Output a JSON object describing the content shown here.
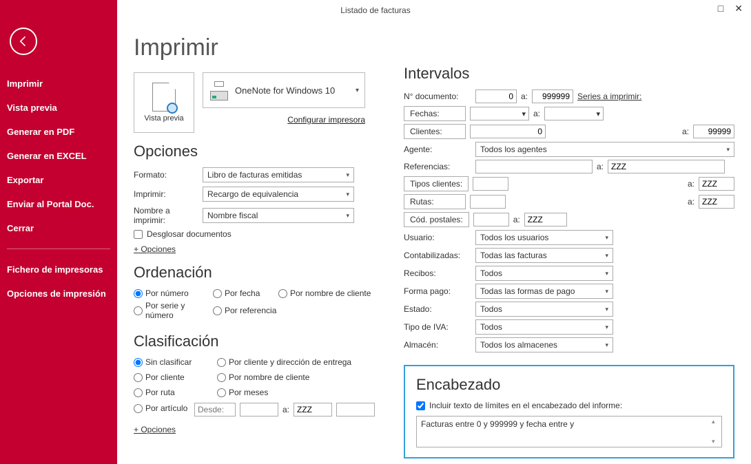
{
  "window": {
    "title": "Listado de facturas"
  },
  "sidebar": {
    "items": [
      "Imprimir",
      "Vista previa",
      "Generar en PDF",
      "Generar en EXCEL",
      "Exportar",
      "Enviar al Portal Doc.",
      "Cerrar"
    ],
    "items2": [
      "Fichero de impresoras",
      "Opciones de impresión"
    ]
  },
  "main": {
    "title": "Imprimir",
    "preview_label": "Vista previa",
    "printer": "OneNote for Windows 10",
    "config_link": "Configurar impresora",
    "opciones_title": "Opciones",
    "formato_label": "Formato:",
    "formato_value": "Libro de facturas emitidas",
    "imprimir_label": "Imprimir:",
    "imprimir_value": "Recargo de equivalencia",
    "nombre_label": "Nombre a imprimir:",
    "nombre_value": "Nombre fiscal",
    "desglosar": "Desglosar documentos",
    "opciones_link": "+ Opciones",
    "ordenacion_title": "Ordenación",
    "orden": [
      "Por número",
      "Por fecha",
      "Por nombre de cliente",
      "Por serie y número",
      "Por referencia"
    ],
    "clasif_title": "Clasificación",
    "clasif": [
      "Sin clasificar",
      "Por cliente y dirección de entrega",
      "Por cliente",
      "Por nombre de cliente",
      "Por ruta",
      "Por meses",
      "Por artículo"
    ],
    "desde": "Desde:",
    "a": "a:",
    "zzz": "ZZZ"
  },
  "intervals": {
    "title": "Intervalos",
    "ndoc": "N° documento:",
    "ndoc_from": "0",
    "ndoc_to": "999999",
    "series": "Series a imprimir:",
    "fechas": "Fechas:",
    "clientes": "Clientes:",
    "cli_from": "0",
    "cli_to": "99999",
    "agente": "Agente:",
    "agente_val": "Todos los agentes",
    "refs": "Referencias:",
    "refs_to": "ZZZ",
    "tipos_cli": "Tipos clientes:",
    "tipos_to": "ZZZ",
    "rutas": "Rutas:",
    "rutas_to": "ZZZ",
    "cpostales": "Cód. postales:",
    "cp_to": "ZZZ",
    "usuario": "Usuario:",
    "usuario_val": "Todos los usuarios",
    "contab": "Contabilizadas:",
    "contab_val": "Todas las facturas",
    "recibos": "Recibos:",
    "recibos_val": "Todos",
    "formapago": "Forma pago:",
    "formapago_val": "Todas las formas de pago",
    "estado": "Estado:",
    "estado_val": "Todos",
    "tipoiva": "Tipo de IVA:",
    "tipoiva_val": "Todos",
    "almacen": "Almacén:",
    "almacen_val": "Todos los almacenes",
    "a": "a:"
  },
  "header": {
    "title": "Encabezado",
    "include": "Incluir texto de límites en el encabezado del informe:",
    "text": "Facturas entre 0 y 999999 y fecha entre  y"
  }
}
